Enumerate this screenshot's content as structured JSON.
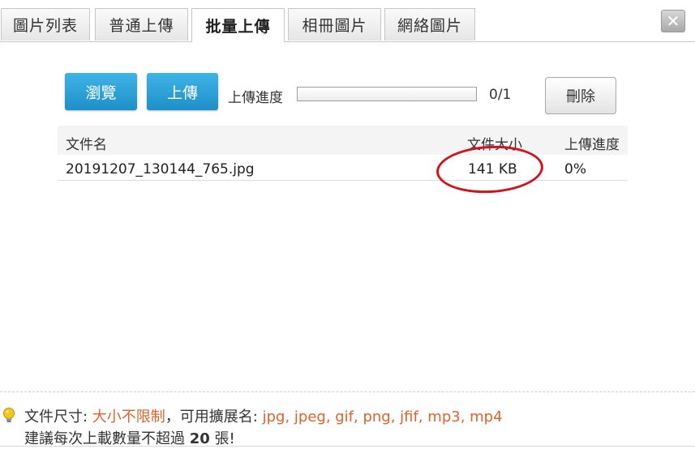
{
  "tabs": [
    {
      "label": "圖片列表",
      "active": false
    },
    {
      "label": "普通上傳",
      "active": false
    },
    {
      "label": "批量上傳",
      "active": true
    },
    {
      "label": "相冊圖片",
      "active": false
    },
    {
      "label": "網絡圖片",
      "active": false
    }
  ],
  "toolbar": {
    "browse_label": "瀏覽",
    "upload_label": "上傳",
    "progress_label": "上傳進度",
    "progress_count": "0/1",
    "progress_fraction": 0,
    "delete_label": "刪除"
  },
  "table": {
    "headers": {
      "name": "文件名",
      "size": "文件大小",
      "progress": "上傳進度"
    },
    "rows": [
      {
        "name": "20191207_130144_765.jpg",
        "size": "141 KB",
        "progress": "0%"
      }
    ]
  },
  "footer": {
    "size_label": "文件尺寸: ",
    "size_value": "大小不限制",
    "ext_label": "，可用擴展名: ",
    "ext_value": "jpg, jpeg, gif, png, jfif, mp3, mp4",
    "advice_prefix": "建議每次上載數量不超過 ",
    "advice_count": "20",
    "advice_suffix": " 張!"
  },
  "colors": {
    "accent_blue": "#2a9fd8",
    "annotation_red": "#d0141e",
    "highlight_orange": "#e0622c"
  },
  "icons": {
    "close": "close-icon",
    "hint": "lightbulb-icon"
  }
}
